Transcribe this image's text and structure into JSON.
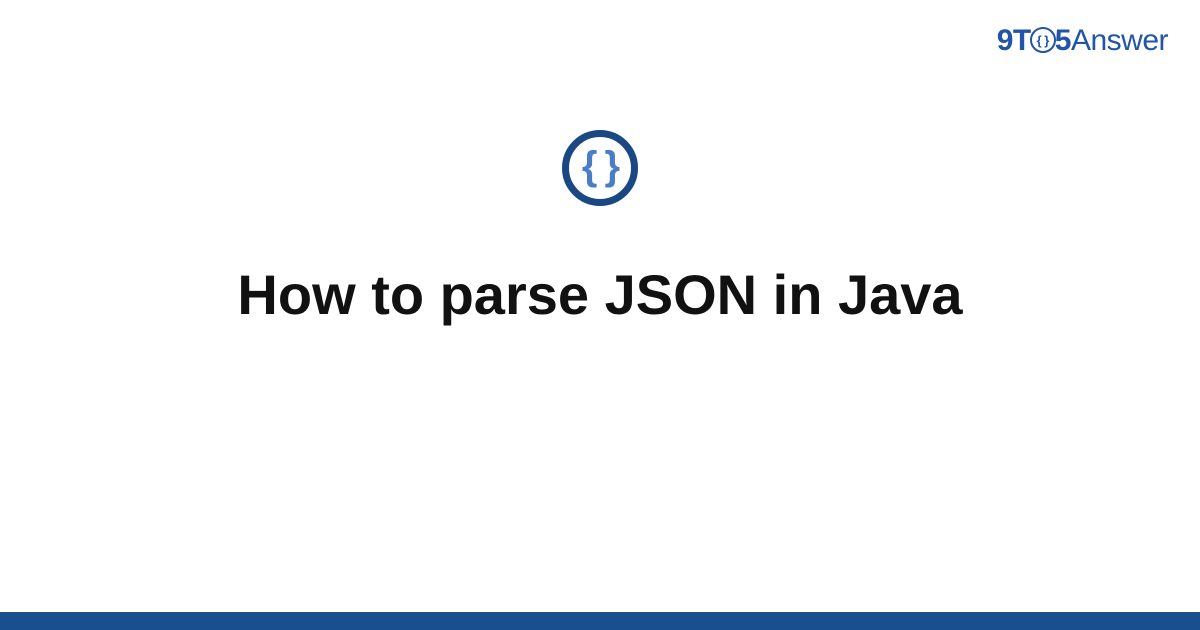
{
  "brand": {
    "part1": "9T",
    "glyph": "{ }",
    "part2": "5",
    "part3": "Answer"
  },
  "icon": {
    "glyph": "{ }"
  },
  "main": {
    "title": "How to parse JSON in Java"
  },
  "colors": {
    "brand_blue": "#2254a8",
    "icon_ring": "#1a4883",
    "icon_braces": "#4a7dc7",
    "footer_bar": "#1a4f8f",
    "title_text": "#111111"
  }
}
